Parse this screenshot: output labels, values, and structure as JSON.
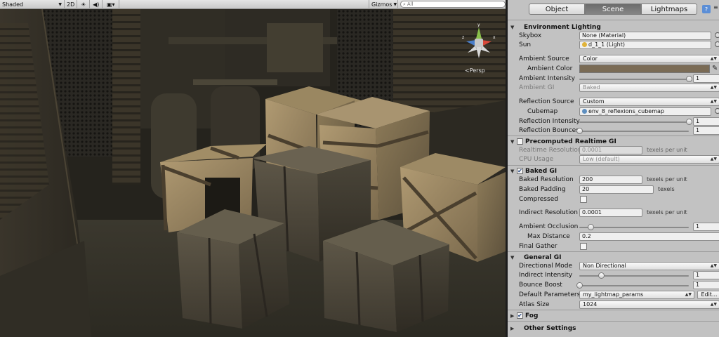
{
  "scene_toolbar": {
    "shading_mode": "Shaded",
    "mode_2d": "2D",
    "light_toggle_icon": "sun-icon",
    "audio_toggle_icon": "speaker-icon",
    "effects_toggle_icon": "image-icon",
    "gizmos_label": "Gizmos",
    "search_placeholder": "All"
  },
  "scene_view": {
    "axis_y": "y",
    "axis_z": "z",
    "axis_x": "x",
    "projection_label": "Persp"
  },
  "tabs": [
    "Object",
    "Scene",
    "Lightmaps"
  ],
  "active_tab": "Scene",
  "environment_lighting": {
    "header": "Environment Lighting",
    "skybox_label": "Skybox",
    "skybox_value": "None (Material)",
    "sun_label": "Sun",
    "sun_value": "d_1_1 (Light)",
    "ambient_source_label": "Ambient Source",
    "ambient_source_value": "Color",
    "ambient_color_label": "Ambient Color",
    "ambient_color": "#7a6b55",
    "ambient_intensity_label": "Ambient Intensity",
    "ambient_intensity_value": "1",
    "ambient_intensity_fraction": 1.0,
    "ambient_gi_label": "Ambient GI",
    "ambient_gi_value": "Baked",
    "reflection_source_label": "Reflection Source",
    "reflection_source_value": "Custom",
    "cubemap_label": "Cubemap",
    "cubemap_value": "env_8_reflexions_cubemap",
    "reflection_intensity_label": "Reflection Intensity",
    "reflection_intensity_value": "1",
    "reflection_intensity_fraction": 1.0,
    "reflection_bounces_label": "Reflection Bounces",
    "reflection_bounces_value": "1",
    "reflection_bounces_fraction": 0.0
  },
  "precomputed_gi": {
    "header": "Precomputed Realtime GI",
    "enabled": false,
    "realtime_resolution_label": "Realtime Resolution",
    "realtime_resolution_value": "0.0001",
    "realtime_resolution_unit": "texels per unit",
    "cpu_usage_label": "CPU Usage",
    "cpu_usage_value": "Low (default)"
  },
  "baked_gi": {
    "header": "Baked GI",
    "enabled": true,
    "baked_resolution_label": "Baked Resolution",
    "baked_resolution_value": "200",
    "baked_resolution_unit": "texels per unit",
    "baked_padding_label": "Baked Padding",
    "baked_padding_value": "20",
    "baked_padding_unit": "texels",
    "compressed_label": "Compressed",
    "compressed": false,
    "indirect_resolution_label": "Indirect Resolution",
    "indirect_resolution_value": "0.0001",
    "indirect_resolution_unit": "texels per unit",
    "ambient_occlusion_label": "Ambient Occlusion",
    "ambient_occlusion_value": "1",
    "ambient_occlusion_fraction": 0.1,
    "max_distance_label": "Max Distance",
    "max_distance_value": "0.2",
    "final_gather_label": "Final Gather",
    "final_gather": false
  },
  "general_gi": {
    "header": "General GI",
    "directional_mode_label": "Directional Mode",
    "directional_mode_value": "Non Directional",
    "indirect_intensity_label": "Indirect Intensity",
    "indirect_intensity_value": "1",
    "indirect_intensity_fraction": 0.2,
    "bounce_boost_label": "Bounce Boost",
    "bounce_boost_value": "1",
    "bounce_boost_fraction": 0.0,
    "default_parameters_label": "Default Parameters",
    "default_parameters_value": "my_lightmap_params",
    "edit_button": "Edit...",
    "atlas_size_label": "Atlas Size",
    "atlas_size_value": "1024"
  },
  "fog": {
    "header": "Fog",
    "enabled": true
  },
  "other_settings": {
    "header": "Other Settings"
  }
}
